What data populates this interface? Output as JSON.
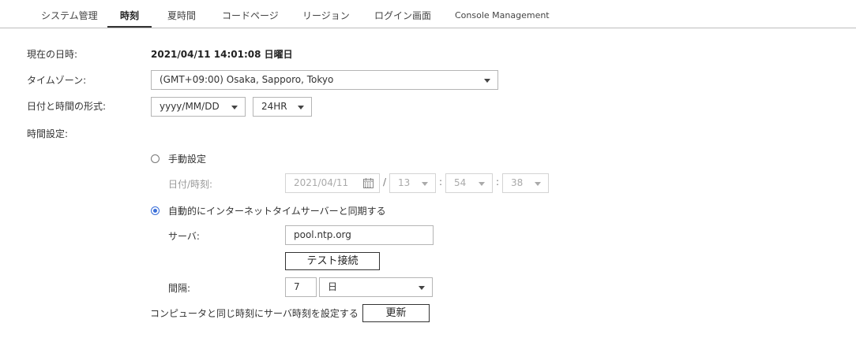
{
  "tabs": [
    {
      "label": "システム管理",
      "active": false
    },
    {
      "label": "時刻",
      "active": true
    },
    {
      "label": "夏時間",
      "active": false
    },
    {
      "label": "コードページ",
      "active": false
    },
    {
      "label": "リージョン",
      "active": false
    },
    {
      "label": "ログイン画面",
      "active": false
    },
    {
      "label": "Console Management",
      "active": false
    }
  ],
  "current": {
    "label": "現在の日時:",
    "value": "2021/04/11 14:01:08 日曜日"
  },
  "timezone": {
    "label": "タイムゾーン:",
    "value": "(GMT+09:00) Osaka, Sapporo, Tokyo"
  },
  "format": {
    "label": "日付と時間の形式:",
    "date_value": "yyyy/MM/DD",
    "time_value": "24HR"
  },
  "time_settings": {
    "label": "時間設定:"
  },
  "manual": {
    "radio_label": "手動設定",
    "selected": false,
    "datetime_label": "日付/時刻:",
    "date_value": "2021/04/11",
    "hour": "13",
    "minute": "54",
    "second": "38",
    "slash": "/",
    "colon": ":"
  },
  "auto": {
    "radio_label": "自動的にインターネットタイムサーバーと同期する",
    "selected": true,
    "server_label": "サーバ:",
    "server_value": "pool.ntp.org",
    "test_button": "テスト接続",
    "interval_label": "間隔:",
    "interval_value": "7",
    "interval_unit": "日"
  },
  "sync": {
    "label": "コンピュータと同じ時刻にサーバ時刻を設定する",
    "button": "更新"
  },
  "colors": {
    "accent": "#3b6fd9",
    "border": "#b5b5b5",
    "disabled_text": "#aaaaaa"
  }
}
